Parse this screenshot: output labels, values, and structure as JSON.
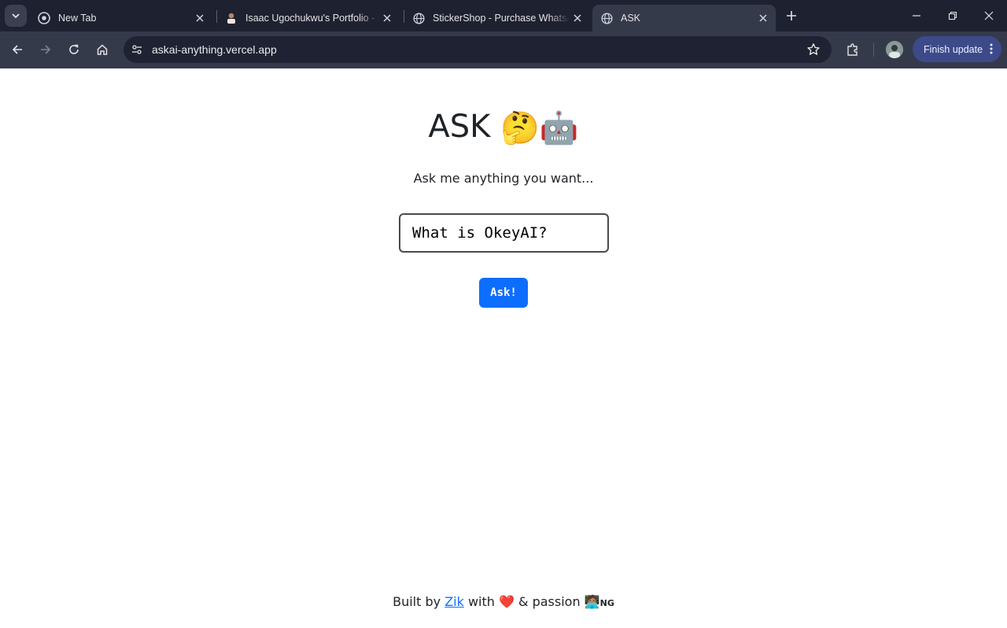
{
  "browser": {
    "tabs": [
      {
        "title": "New Tab",
        "icon": "chrome-icon",
        "active": false
      },
      {
        "title": "Isaac Ugochukwu's Portfolio - F",
        "icon": "portfolio-favicon",
        "active": false
      },
      {
        "title": "StickerShop - Purchase WhatsA",
        "icon": "globe-icon",
        "active": false
      },
      {
        "title": "ASK",
        "icon": "globe-icon",
        "active": true
      }
    ],
    "url": "askai-anything.vercel.app",
    "finish_update_label": "Finish update"
  },
  "page": {
    "heading": "ASK",
    "heading_emojis": [
      "🤔",
      "🤖"
    ],
    "subtitle": "Ask me anything you want...",
    "question_value": "What is OkeyAI?",
    "ask_button_label": "Ask!",
    "footer": {
      "built_by": "Built by",
      "author_link": "Zik",
      "with": "with",
      "heart": "❤️",
      "and_passion": "& passion",
      "coder_emoji": "🧑🏽‍💻",
      "country": "NG"
    }
  },
  "colors": {
    "tabstrip_bg": "#1e2130",
    "toolbar_bg": "#353a4b",
    "accent_button": "#0d6efd",
    "finish_update_bg": "#3d4a8a"
  }
}
